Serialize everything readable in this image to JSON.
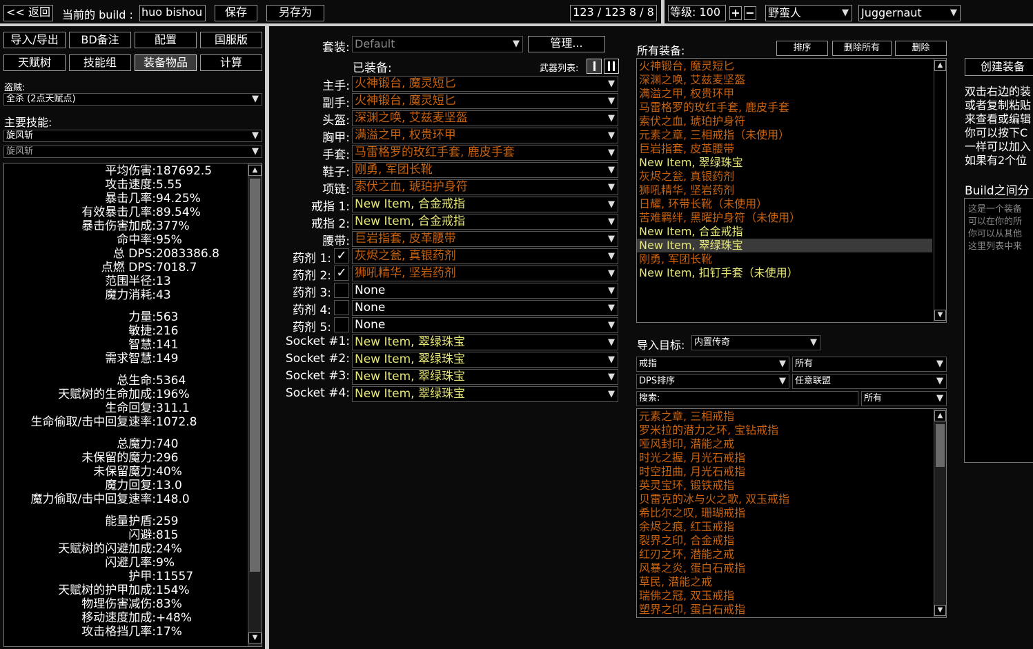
{
  "topbar": {
    "back": "<< 返回",
    "current_build_label": "当前的 build :",
    "build_name": "huo bishou",
    "save": "保存",
    "save_as": "另存为",
    "points": "123 / 123   8 / 8",
    "level_label": "等级: 100",
    "plus": "+",
    "minus": "−",
    "class": "野蛮人",
    "ascendancy": "Juggernaut"
  },
  "left_tabs": {
    "row1": [
      "导入/导出",
      "BD备注",
      "配置",
      "国服版"
    ],
    "row2": [
      "天赋树",
      "技能组",
      "装备物品",
      "计算"
    ]
  },
  "left": {
    "bandit_label": "盗贼:",
    "bandit_value": "全杀 (2点天赋点)",
    "main_skill_label": "主要技能:",
    "main_skill_value": "旋风斩",
    "sub_skill_value": "旋风斩",
    "stats": [
      {
        "k": "平均伤害:",
        "v": "187692.5"
      },
      {
        "k": "攻击速度:",
        "v": "5.55"
      },
      {
        "k": "暴击几率:",
        "v": "94.25%"
      },
      {
        "k": "有效暴击几率:",
        "v": "89.54%"
      },
      {
        "k": "暴击伤害加成:",
        "v": "377%"
      },
      {
        "k": "命中率:",
        "v": "95%"
      },
      {
        "k": "总 DPS:",
        "v": "2083386.8"
      },
      {
        "k": "点燃 DPS:",
        "v": "7018.7"
      },
      {
        "k": "范围半径:",
        "v": "13"
      },
      {
        "k": "魔力消耗:",
        "v": "43"
      },
      {
        "k": "",
        "v": ""
      },
      {
        "k": "力量:",
        "v": "563"
      },
      {
        "k": "敏捷:",
        "v": "216"
      },
      {
        "k": "智慧:",
        "v": "141"
      },
      {
        "k": "需求智慧:",
        "v": "149"
      },
      {
        "k": "",
        "v": ""
      },
      {
        "k": "总生命:",
        "v": "5364"
      },
      {
        "k": "天赋树的生命加成:",
        "v": "196%"
      },
      {
        "k": "生命回复:",
        "v": "311.1"
      },
      {
        "k": "生命偷取/击中回复速率:",
        "v": "1072.8"
      },
      {
        "k": "",
        "v": ""
      },
      {
        "k": "总魔力:",
        "v": "740"
      },
      {
        "k": "未保留的魔力:",
        "v": "296"
      },
      {
        "k": "未保留魔力:",
        "v": "40%"
      },
      {
        "k": "魔力回复:",
        "v": "13.0"
      },
      {
        "k": "魔力偷取/击中回复速率:",
        "v": "148.0"
      },
      {
        "k": "",
        "v": ""
      },
      {
        "k": "能量护盾:",
        "v": "259"
      },
      {
        "k": "闪避:",
        "v": "815"
      },
      {
        "k": "天赋树的闪避加成:",
        "v": "24%"
      },
      {
        "k": "闪避几率:",
        "v": "9%"
      },
      {
        "k": "护甲:",
        "v": "11557"
      },
      {
        "k": "天赋树的护甲加成:",
        "v": "154%"
      },
      {
        "k": "物理伤害减伤:",
        "v": "83%"
      },
      {
        "k": "移动速度加成:",
        "v": "+48%"
      },
      {
        "k": "攻击格挡几率:",
        "v": "17%"
      }
    ]
  },
  "middle": {
    "set_label": "套装:",
    "set_value": "Default",
    "manage": "管理...",
    "equipped_label": "已装备:",
    "weapon_list_label": "武器列表:",
    "slots": [
      {
        "label": "主手:",
        "value": "火神锻台, 魔灵短匕",
        "color": "orange",
        "check": ""
      },
      {
        "label": "副手:",
        "value": "火神锻台, 魔灵短匕",
        "color": "orange",
        "check": ""
      },
      {
        "label": "头盔:",
        "value": "深渊之唤, 艾兹麦坚盔",
        "color": "orange",
        "check": ""
      },
      {
        "label": "胸甲:",
        "value": "满溢之甲, 权贵环甲",
        "color": "orange",
        "check": ""
      },
      {
        "label": "手套:",
        "value": "马雷格罗的玫红手套, 鹿皮手套",
        "color": "orange",
        "check": ""
      },
      {
        "label": "鞋子:",
        "value": "刚勇, 军团长靴",
        "color": "orange",
        "check": ""
      },
      {
        "label": "项链:",
        "value": "索伏之血, 琥珀护身符",
        "color": "orange",
        "check": ""
      },
      {
        "label": "戒指 1:",
        "value": "New Item, 合金戒指",
        "color": "yellow",
        "check": ""
      },
      {
        "label": "戒指 2:",
        "value": "New Item, 合金戒指",
        "color": "yellow",
        "check": ""
      },
      {
        "label": "腰带:",
        "value": "巨岩指套, 皮革腰带",
        "color": "orange",
        "check": ""
      },
      {
        "label": "药剂 1:",
        "value": "灰烬之瓮, 真银药剂",
        "color": "orange",
        "check": "✓"
      },
      {
        "label": "药剂 2:",
        "value": "狮吼精华, 坚岩药剂",
        "color": "orange",
        "check": "✓"
      },
      {
        "label": "药剂 3:",
        "value": "None",
        "color": "white",
        "check": " "
      },
      {
        "label": "药剂 4:",
        "value": "None",
        "color": "white",
        "check": " "
      },
      {
        "label": "药剂 5:",
        "value": "None",
        "color": "white",
        "check": " "
      },
      {
        "label": "Socket #1:",
        "value": "New Item, 翠绿珠宝",
        "color": "yellow",
        "check": ""
      },
      {
        "label": "Socket #2:",
        "value": "New Item, 翠绿珠宝",
        "color": "yellow",
        "check": ""
      },
      {
        "label": "Socket #3:",
        "value": "New Item, 翠绿珠宝",
        "color": "yellow",
        "check": ""
      },
      {
        "label": "Socket #4:",
        "value": "New Item, 翠绿珠宝",
        "color": "yellow",
        "check": ""
      }
    ]
  },
  "items": {
    "all_label": "所有装备:",
    "sort": "排序",
    "delete_all": "删除所有",
    "delete": "删除",
    "list": [
      {
        "text": "火神锻台, 魔灵短匕",
        "color": "orange"
      },
      {
        "text": "深渊之唤, 艾兹麦坚盔",
        "color": "orange"
      },
      {
        "text": "满溢之甲, 权贵环甲",
        "color": "orange"
      },
      {
        "text": "马雷格罗的玫红手套, 鹿皮手套",
        "color": "orange"
      },
      {
        "text": "索伏之血, 琥珀护身符",
        "color": "orange"
      },
      {
        "text": "元素之章, 三相戒指（未使用）",
        "color": "orange"
      },
      {
        "text": "巨岩指套, 皮革腰带",
        "color": "orange"
      },
      {
        "text": "New Item, 翠绿珠宝",
        "color": "yellow"
      },
      {
        "text": "灰烬之瓮, 真银药剂",
        "color": "orange"
      },
      {
        "text": "狮吼精华, 坚岩药剂",
        "color": "orange"
      },
      {
        "text": "日耀, 环带长靴（未使用）",
        "color": "orange"
      },
      {
        "text": "苦难羁绊, 黑曜护身符（未使用）",
        "color": "orange"
      },
      {
        "text": "New Item, 合金戒指",
        "color": "yellow"
      },
      {
        "text": "New Item, 翠绿珠宝",
        "color": "yellow"
      },
      {
        "text": "刚勇, 军团长靴",
        "color": "orange"
      },
      {
        "text": "New Item, 扣钉手套（未使用）",
        "color": "yellow"
      }
    ],
    "import_label": "导入目标:",
    "import_value": "内置传奇",
    "filter1": "戒指",
    "filter2": "所有",
    "filter3": "DPS排序",
    "filter4": "任意联盟",
    "search_label": "搜索:",
    "search_filter": "所有",
    "db": [
      "元素之章, 三相戒指",
      "罗米拉的潜力之环, 宝钻戒指",
      "哑风封印, 潜能之戒",
      "时光之握, 月光石戒指",
      "时空扭曲, 月光石戒指",
      "英灵宝环, 锻铁戒指",
      "贝雷克的冰与火之歌, 双玉戒指",
      "希比尔之叹, 珊瑚戒指",
      "余烬之痕, 红玉戒指",
      "裂界之印, 合金戒指",
      "红刃之环, 潜能之戒",
      "风暴之炎, 蛋白石戒指",
      "草民, 潜能之戒",
      "瑞佛之冠, 双玉戒指",
      "塑界之印, 蛋白石戒指"
    ]
  },
  "right": {
    "create": "创建装备",
    "help_lines": [
      "双击右边的装",
      "或者复制粘贴",
      "来查看或编辑",
      "你可以按下C",
      "一样可以加入",
      "如果有2个位"
    ],
    "shared_label": "Build之间分",
    "shared_lines": [
      "这是一个装备",
      "可以在你的所",
      "你可以从其他",
      "这里列表中来"
    ]
  },
  "colors": {
    "orange": "#c8620e",
    "yellow": "#e6e678",
    "background": "#0b0b0b"
  }
}
